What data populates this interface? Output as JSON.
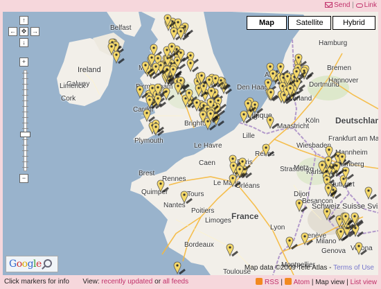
{
  "top_links": {
    "send": "Send",
    "separator": "|",
    "link": "Link"
  },
  "map_type": {
    "map": "Map",
    "satellite": "Satellite",
    "hybrid": "Hybrid",
    "selected": "Map"
  },
  "nav_controls": {
    "up": "↑",
    "down": "↓",
    "left": "←",
    "right": "→",
    "center": "✥",
    "zoom_in": "+",
    "zoom_out": "−"
  },
  "zoom_level_fraction": 0.64,
  "attribution": {
    "text": "Map data ©2009 Tele Atlas -",
    "terms": "Terms of Use"
  },
  "logo": {
    "text": "Google"
  },
  "footer": {
    "info": "Click markers for info",
    "view_label": "View:",
    "recently_updated": "recently updated",
    "or": "or",
    "all_feeds": "all feeds",
    "rss": "RSS",
    "atom": "Atom",
    "map_view": "Map view",
    "list_view": "List view",
    "sep": "|"
  },
  "places": [
    "Belfast",
    "Ireland",
    "Galway",
    "Limerick",
    "Cork",
    "Manchester",
    "Birmingham",
    "Cardiff",
    "Plymouth",
    "Brighton",
    "Amsterdam",
    "Den Haag",
    "Belgique",
    "Lille",
    "Köln",
    "Deutschland",
    "Hamburg",
    "Bremen",
    "Hannover",
    "Frankfurt am Main",
    "Nürnberg",
    "Wiesbaden",
    "Karlsruhe",
    "Stuttgart",
    "Strasbourg",
    "Reims",
    "Le Havre",
    "Caen",
    "Brest",
    "Rennes",
    "Quimper",
    "Nantes",
    "Le Mans",
    "Orléans",
    "Paris",
    "France",
    "Dijon",
    "Besançon",
    "Lyon",
    "Limoges",
    "Bordeaux",
    "Toulouse",
    "Montpellier",
    "Genève",
    "Schweiz Suisse Svizzera",
    "Milano",
    "Verona",
    "Genova",
    "Nederland",
    "Maastricht",
    "Metz",
    "Mannheim",
    "Tours",
    "Poitiers",
    "Dortmund"
  ],
  "colors": {
    "frame": "#f6d7dc",
    "sea": "#99b3cc",
    "land": "#f2efe9",
    "accent_link": "#c0306a",
    "marker_fill": "#f4d86a",
    "marker_outline": "#555555"
  }
}
